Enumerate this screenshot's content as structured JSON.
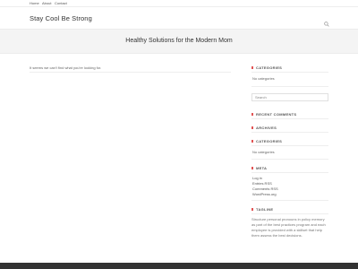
{
  "topbar": {
    "links": [
      "Home",
      "About",
      "Contact"
    ]
  },
  "header": {
    "site_title": "Stay Cool Be Strong",
    "search_icon": "search-icon"
  },
  "hero": {
    "title": "Healthy Solutions for the Modern Mom"
  },
  "main": {
    "not_found_text": "It seems we can't find what you're looking for."
  },
  "sidebar": {
    "categories_title": "CATEGORIES",
    "no_categories": "No categories",
    "search_placeholder": "Search",
    "recent_comments_title": "RECENT COMMENTS",
    "archives_title": "ARCHIVES",
    "categories2_title": "CATEGORIES",
    "no_categories2": "No categories",
    "meta_title": "META",
    "meta_links": [
      "Log in",
      "Entries RSS",
      "Comments RSS",
      "WordPress.org"
    ],
    "tagline_title": "TAGLINE",
    "tagline_text": "Structure personal pronouns in policy memory as part of the best practices program and each employee is provided with a skillset that help them assess the best decisions."
  },
  "colors": {
    "accent": "#e25555",
    "hero_bg": "#f4f4f4",
    "footer_bg": "#333333"
  }
}
